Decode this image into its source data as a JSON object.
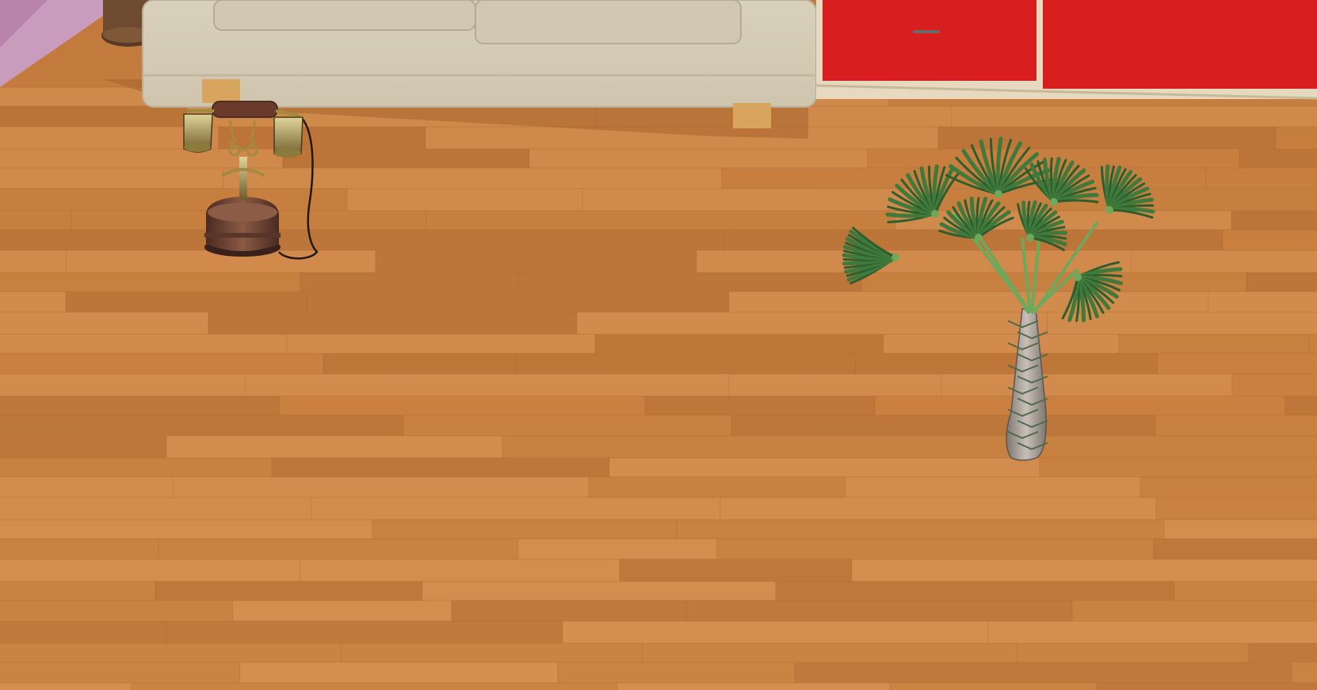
{
  "scene": {
    "description_visible_text": "",
    "colors": {
      "floor_base": "#c8803f",
      "floor_light": "#d89456",
      "floor_dark": "#b56d33",
      "wall": "#c89ab8",
      "sofa": "#d6cdb8",
      "sofa_shadow": "#b9ae98",
      "cabinet": "#d41c1c",
      "cabinet_frame": "#e8dcc4",
      "brass": "#b59a4a",
      "telephone_body": "#6b3a2c",
      "palm_leaf": "#3f7a3c",
      "palm_trunk": "#a39a92"
    },
    "objects": {
      "sofa": {
        "icon": "sofa-icon"
      },
      "cabinet": {
        "icon": "cabinet-icon"
      },
      "telephone": {
        "icon": "antique-telephone-icon"
      },
      "palm": {
        "icon": "palm-tree-icon"
      },
      "vase": {
        "icon": "vase-icon"
      }
    }
  }
}
